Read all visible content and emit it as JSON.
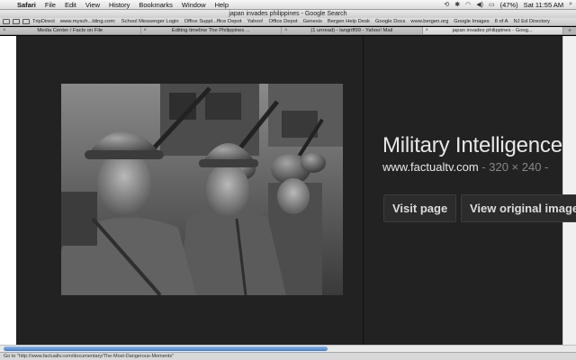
{
  "menubar": {
    "app": "Safari",
    "items": [
      "File",
      "Edit",
      "View",
      "History",
      "Bookmarks",
      "Window",
      "Help"
    ],
    "battery": "(47%)",
    "clock": "Sat 11:55 AM"
  },
  "window": {
    "title": "japan invades philippines - Google Search"
  },
  "bookmarks": [
    "TripDirect",
    "www.mysch...lding.com:",
    "School Messenger Login",
    "Office Suppl...ffice Depot",
    "Yahoo!",
    "Office Depot",
    "Genesis",
    "Bergen Help Desk",
    "Google Docs",
    "www.bergen.org",
    "Google Images",
    "8 of A",
    "NJ Ed Directory"
  ],
  "tabs": [
    {
      "label": "Media Center / Facts on File",
      "active": false
    },
    {
      "label": "Editing timeline The Philippines ...",
      "active": false
    },
    {
      "label": "(1 unread) - langriff99 - Yahoo! Mail",
      "active": false
    },
    {
      "label": "japan invades philippines - Goog...",
      "active": true
    }
  ],
  "tab_add": "+",
  "image_panel": {
    "title": "Military Intelligence",
    "domain": "www.factualtv.com",
    "meta": " - 320 × 240 - ",
    "visit_label": "Visit page",
    "view_label": "View original image"
  },
  "status": {
    "text": "Go to \"http://www.factualtv.com/documentary/The-Most-Dangerous-Moments\""
  },
  "colors": {
    "panel_bg": "#222222",
    "scroll_thumb": "#3f7fd1"
  }
}
